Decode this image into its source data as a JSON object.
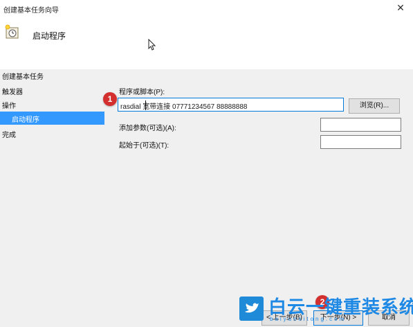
{
  "window": {
    "title": "创建基本任务向导",
    "close_glyph": "✕"
  },
  "header": {
    "title": "启动程序",
    "icon": "clock-task-icon"
  },
  "nav": {
    "section_title": "创建基本任务",
    "items": [
      {
        "label": "触发器"
      },
      {
        "label": "操作"
      },
      {
        "label": "启动程序",
        "selected": true
      },
      {
        "label": "完成"
      }
    ]
  },
  "form": {
    "program_label": "程序或脚本(P):",
    "program_value": "rasdial 宽带连接 07771234567  88888888",
    "browse_label": "浏览(R)...",
    "args_label": "添加参数(可选)(A):",
    "args_value": "",
    "startin_label": "起始于(可选)(T):",
    "startin_value": ""
  },
  "buttons": {
    "back": "< 上一步(B)",
    "next": "下一步(N) >",
    "cancel": "取消"
  },
  "callouts": {
    "one": "1",
    "two": "2"
  },
  "watermark": {
    "text": "白云一键重装系统",
    "url": "baiyunxitong.com"
  },
  "colors": {
    "selection": "#3399ff",
    "badge": "#d32f2f",
    "brand": "#1e88e5"
  }
}
